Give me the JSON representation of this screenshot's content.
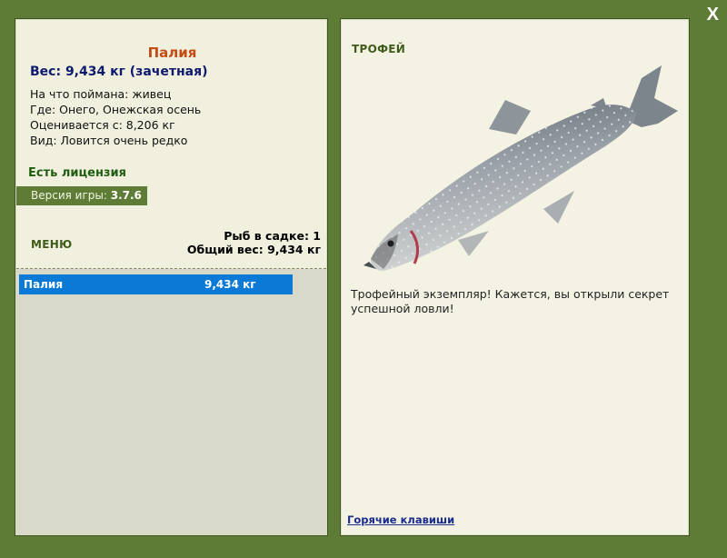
{
  "window": {
    "close_label": "X"
  },
  "fish": {
    "name": "Палия",
    "weight_line": "Вес: 9,434 кг (зачетная)",
    "bait": "На что поймана: живец",
    "location": "Где: Онего, Онежская осень",
    "value": "Оценивается с: 8,206 кг",
    "rarity": "Вид: Ловится очень редко"
  },
  "license": "Есть лицензия",
  "version": {
    "label": "Версия игры:",
    "value": "3.7.6"
  },
  "menu": {
    "title": "МЕНЮ"
  },
  "keepnet": {
    "count": "Рыб в садке: 1",
    "total_weight": "Общий вес: 9,434 кг"
  },
  "catch_list": [
    {
      "name": "Палия",
      "weight": "9,434 кг"
    }
  ],
  "trophy": {
    "title": "ТРОФЕЙ",
    "text": "Трофейный экземпляр! Кажется, вы открыли секрет успешной ловли!",
    "image_icon": "char-fish-image"
  },
  "hotkeys_label": "Горячие клавиши",
  "colors": {
    "frame": "#5f7c36",
    "panel": "#f1f0df",
    "selection": "#0a7ad6",
    "fish_name": "#c24c12"
  }
}
